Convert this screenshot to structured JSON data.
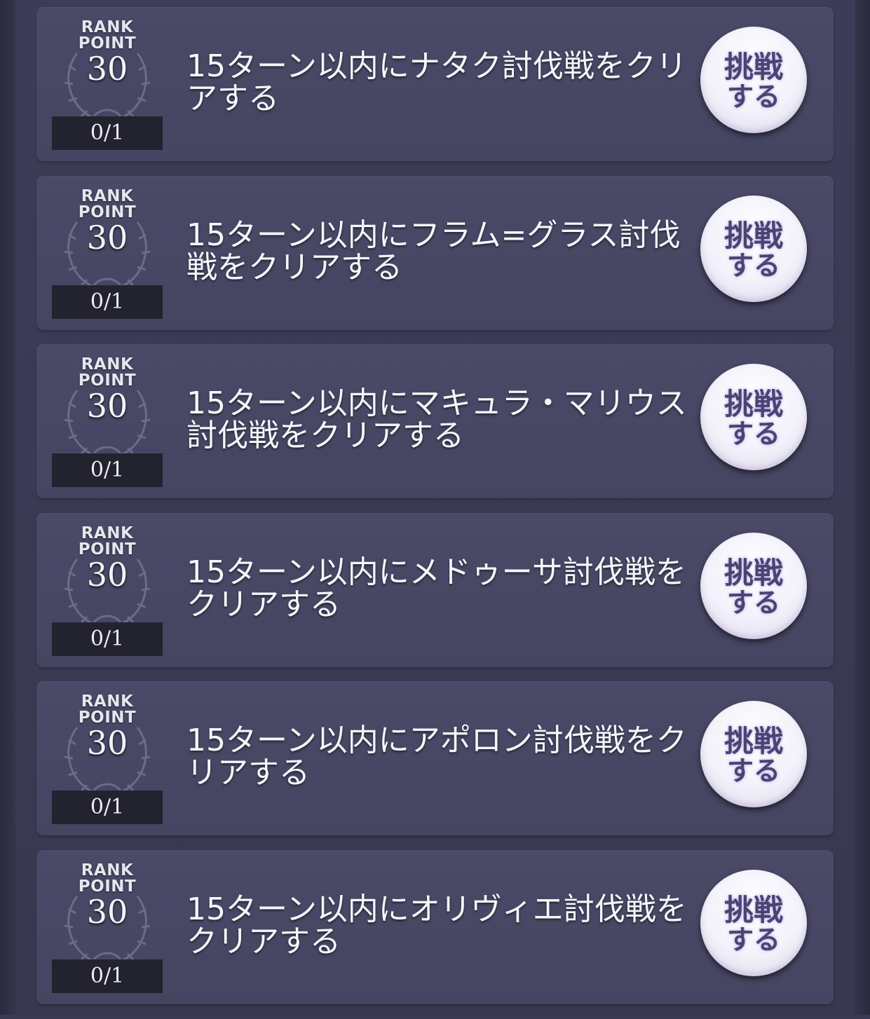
{
  "missions": [
    {
      "rank_label_1": "RANK",
      "rank_label_2": "POINT",
      "rank_point": "30",
      "progress": "0/1",
      "text": "15ターン以内にナタク討伐戦をクリアする",
      "button_line1": "挑戦",
      "button_line2": "する"
    },
    {
      "rank_label_1": "RANK",
      "rank_label_2": "POINT",
      "rank_point": "30",
      "progress": "0/1",
      "text": "15ターン以内にフラム=グラス討伐戦をクリアする",
      "button_line1": "挑戦",
      "button_line2": "する"
    },
    {
      "rank_label_1": "RANK",
      "rank_label_2": "POINT",
      "rank_point": "30",
      "progress": "0/1",
      "text": "15ターン以内にマキュラ・マリウス討伐戦をクリアする",
      "button_line1": "挑戦",
      "button_line2": "する"
    },
    {
      "rank_label_1": "RANK",
      "rank_label_2": "POINT",
      "rank_point": "30",
      "progress": "0/1",
      "text": "15ターン以内にメドゥーサ討伐戦をクリアする",
      "button_line1": "挑戦",
      "button_line2": "する"
    },
    {
      "rank_label_1": "RANK",
      "rank_label_2": "POINT",
      "rank_point": "30",
      "progress": "0/1",
      "text": "15ターン以内にアポロン討伐戦をクリアする",
      "button_line1": "挑戦",
      "button_line2": "する"
    },
    {
      "rank_label_1": "RANK",
      "rank_label_2": "POINT",
      "rank_point": "30",
      "progress": "0/1",
      "text": "15ターン以内にオリヴィエ討伐戦をクリアする",
      "button_line1": "挑戦",
      "button_line2": "する"
    }
  ],
  "colors": {
    "background": "#3a3a55",
    "card": "#4a4a68",
    "progress_bg": "#23232f",
    "button_text": "#4a4470"
  }
}
